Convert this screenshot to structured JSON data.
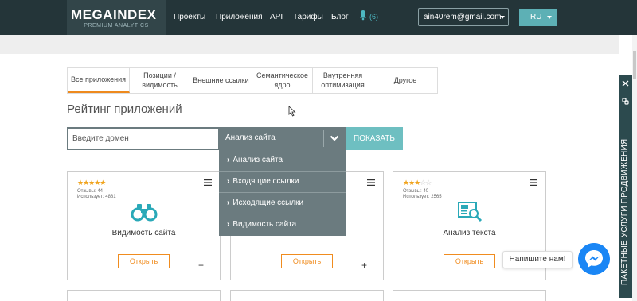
{
  "header": {
    "logo_main": "MEGAINDEX",
    "logo_sub": "PREMIUM ANALYTICS",
    "nav": [
      "Проекты",
      "Приложения",
      "API",
      "Тарифы",
      "Блог"
    ],
    "notifications": "(6)",
    "email": "ain40rem@gmail.com",
    "lang": "RU"
  },
  "tabs": [
    {
      "label": "Все приложения",
      "active": true
    },
    {
      "label": "Позиции /\nвидимость",
      "active": false
    },
    {
      "label": "Внешние ссылки",
      "active": false
    },
    {
      "label": "Семантическое\nядро",
      "active": false
    },
    {
      "label": "Внутренняя\nоптимизация",
      "active": false
    },
    {
      "label": "Другое",
      "active": false
    }
  ],
  "page_title": "Рейтинг приложений",
  "search": {
    "placeholder": "Введите домен",
    "select_value": "Анализ сайта",
    "show_button": "ПОКАЗАТЬ"
  },
  "dropdown": {
    "items": [
      "Анализ сайта",
      "Входящие ссылки",
      "Исходящие ссылки",
      "Видимость сайта"
    ]
  },
  "cards": [
    {
      "rating": 4.5,
      "reviews": "Отзывы: 44",
      "users": "Использует: 4881",
      "icon": "binoculars-icon",
      "title": "Видимость сайта",
      "open": "Открыть"
    },
    {
      "rating": null,
      "reviews": "",
      "users": "",
      "icon": "",
      "title": "",
      "open": "Открыть"
    },
    {
      "rating": 3,
      "reviews": "Отзывы: 40",
      "users": "Использует: 2565",
      "icon": "text-analysis-icon",
      "title": "Анализ текста",
      "open": "Открыть"
    }
  ],
  "chat": {
    "bubble": "Напишите нам!"
  },
  "side_tab": {
    "label": "ПАКЕТНЫЕ УСЛУГИ ПРОДВИЖЕНИЯ"
  },
  "colors": {
    "header": "#243539",
    "accent_orange": "#f08c1f",
    "teal": "#6ebfc1",
    "select_grey": "#6b7b7f",
    "messenger": "#1a86f5"
  }
}
